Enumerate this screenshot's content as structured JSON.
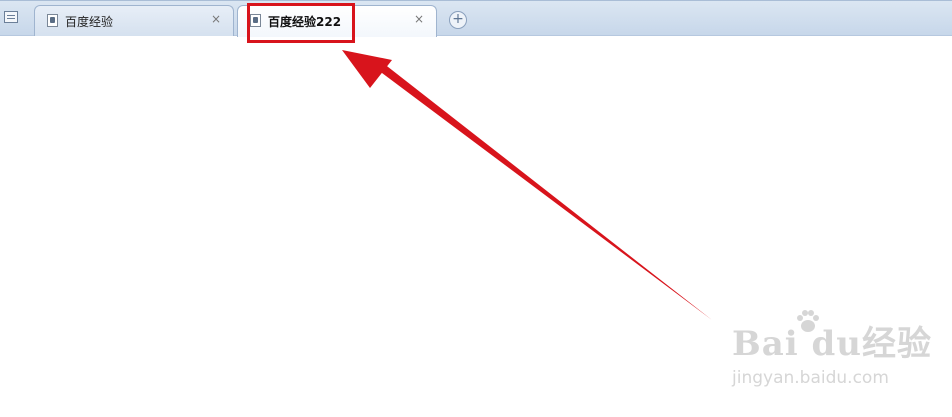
{
  "tabs": [
    {
      "title": "百度经验",
      "close": "×"
    },
    {
      "title": "百度经验222",
      "close": "×"
    }
  ],
  "new_tab_symbol": "+",
  "watermark": {
    "brand": "Bai du经验",
    "url": "jingyan.baidu.com"
  },
  "annotation_color": "#d8141c"
}
